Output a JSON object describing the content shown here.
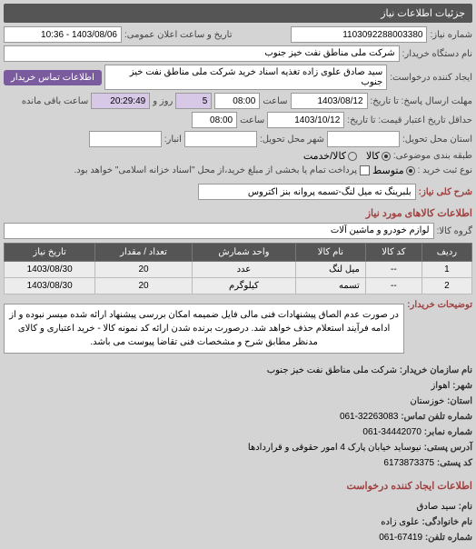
{
  "header": "جزئیات اطلاعات نیاز",
  "fields": {
    "request_no_label": "شماره نیاز:",
    "request_no": "1103092288003380",
    "announce_label": "تاریخ و ساعت اعلان عمومی:",
    "announce": "1403/08/06 - 10:36",
    "device_label": "نام دستگاه خریدار:",
    "device": "شرکت ملی مناطق نفت خیز جنوب",
    "creator_label": "ایجاد کننده درخواست:",
    "creator": "سید صادق علوی زاده  تغذیه اسناد خرید  شرکت ملی مناطق نفت خیز جنوب",
    "contact_btn": "اطلاعات تماس خریدار",
    "deadline_label": "مهلت ارسال پاسخ: تا تاریخ:",
    "deadline_date": "1403/08/12",
    "deadline_time_label": "ساعت",
    "deadline_time": "08:00",
    "days_count": "5",
    "days_label": "روز و",
    "remain_time": "20:29:49",
    "remain_label": "ساعت باقی مانده",
    "valid_label": "حداقل تاریخ اعتبار قیمت: تا تاریخ:",
    "valid_date": "1403/10/12",
    "valid_time": "08:00",
    "province_label": "استان محل تحویل:",
    "city_label": "شهر محل تحویل:",
    "floor_label": "انبار:",
    "pkg_label": "طبقه بندی موضوعی:",
    "rk_kala": "کالا",
    "rk_khadamat": "کالا/خدمت",
    "price_label": "نوع ثبت خرید :",
    "rk_mid": "متوسط",
    "pay_note": "پرداخت تمام یا بخشی از مبلغ خرید،از محل \"اسناد خزانه اسلامی\" خواهد بود.",
    "keyword_label": "شرح کلی نیاز:",
    "keyword": "بلبرینگ ته میل لنگ-تسمه پروانه بنز اکتروس",
    "goods_section": "اطلاعات کالاهای مورد نیاز",
    "group_label": "گروه کالا:",
    "group": "لوازم خودرو و ماشین آلات",
    "desc_label": "توضیحات خریدار:",
    "desc": "در صورت عدم الصاق پیشنهادات فنی مالی فایل ضمیمه امکان بررسی پیشنهاد ارائه شده میسر نبوده و از ادامه فرآیند استعلام حذف خواهد شد. درصورت برنده شدن ارائه کد نمونه کالا - خرید اعتباری و کالای مدنظر مطابق شرح و مشخصات فنی تقاضا پیوست می باشد."
  },
  "table": {
    "headers": [
      "ردیف",
      "کد کالا",
      "نام کالا",
      "واحد شمارش",
      "تعداد / مقدار",
      "تاریخ نیاز"
    ],
    "rows": [
      [
        "1",
        "--",
        "میل لنگ",
        "عدد",
        "20",
        "1403/08/30"
      ],
      [
        "2",
        "--",
        "تسمه",
        "کیلوگرم",
        "20",
        "1403/08/30"
      ]
    ]
  },
  "org": {
    "org_label": "نام سازمان خریدار:",
    "org": "شرکت ملی مناطق نفت خیز جنوب",
    "city_label": "شهر:",
    "city": "اهواز",
    "province_label": "استان:",
    "province": "خوزستان",
    "tel_label": "شماره تلفن تماس:",
    "tel": "32263083-061",
    "fax_label": "شماره نمابر:",
    "fax": "34442070-061",
    "addr_label": "آدرس پستی:",
    "addr": "نیوساید خیابان پارک 4 امور حقوقی و قراردادها",
    "post_label": "کد پستی:",
    "post": "6173873375",
    "creator_section": "اطلاعات ایجاد کننده درخواست",
    "name_label": "نام:",
    "name": "سید صادق",
    "lname_label": "نام خانوادگی:",
    "lname": "علوی زاده",
    "phone_label": "شماره تلفن:",
    "phone": "67419-061"
  }
}
